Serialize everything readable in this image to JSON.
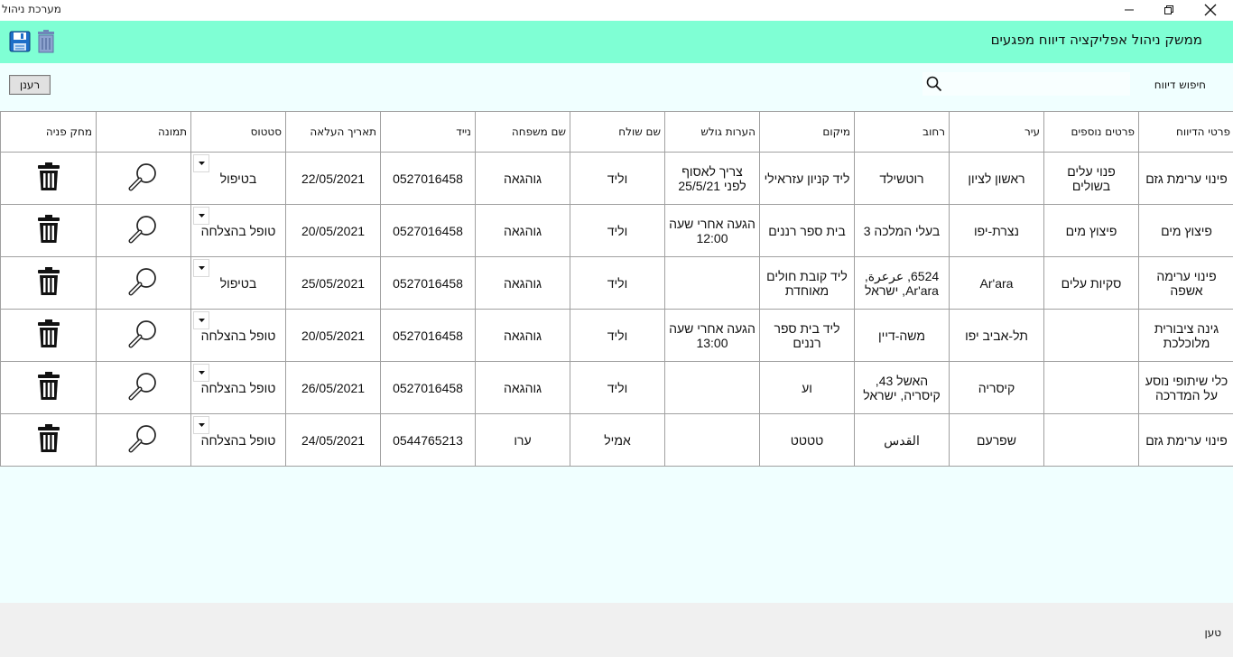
{
  "window": {
    "title": "מערכת ניהול",
    "controls": [
      "minimize",
      "restore",
      "close"
    ]
  },
  "banner": {
    "title": "ממשק ניהול אפליקציה דיווח מפגעים",
    "color": "#7fffd4",
    "icons": [
      "save-icon",
      "trash-icon"
    ]
  },
  "toolbar": {
    "refresh_label": "רענן",
    "search_label": "חיפוש דיווח",
    "search_value": ""
  },
  "table": {
    "columns": [
      "פרטי הדיווח",
      "פרטים נוספים",
      "עיר",
      "רחוב",
      "מיקום",
      "הערות גולש",
      "שם שולח",
      "שם משפחה",
      "נייד",
      "תאריך העלאה",
      "סטטוס",
      "תמונה",
      "מחק פניה"
    ],
    "rows": [
      {
        "details": "פינוי ערימת גזם",
        "extra": "פנוי עלים בשולים",
        "city": "ראשון לציון",
        "street": "רוטשילד",
        "location": "ליד קניון עזראילי",
        "notes": "צריך לאסוף לפני 25/5/21",
        "first_name": "וליד",
        "last_name": "גוהגאה",
        "phone": "0527016458",
        "date": "22/05/2021",
        "status": "בטיפול"
      },
      {
        "details": "פיצוץ מים",
        "extra": "פיצוץ מים",
        "city": "נצרת-יפו",
        "street": "בעלי המלכה 3",
        "location": "בית ספר רננים",
        "notes": "הגעה אחרי שעה 12:00",
        "first_name": "וליד",
        "last_name": "גוהגאה",
        "phone": "0527016458",
        "date": "20/05/2021",
        "status": "טופל בהצלחה"
      },
      {
        "details": "פינוי ערימה אשפה",
        "extra": "סקיות עלים",
        "city": "Ar'ara",
        "street": "6524, عرعرة, Ar'ara, ישראל",
        "location": "ליד קובת חולים מאוחדת",
        "notes": "",
        "first_name": "וליד",
        "last_name": "גוהגאה",
        "phone": "0527016458",
        "date": "25/05/2021",
        "status": "בטיפול"
      },
      {
        "details": "גינה ציבורית מלוכלכת",
        "extra": "",
        "city": "תל-אביב יפו",
        "street": "משה-דיין",
        "location": "ליד בית ספר רננים",
        "notes": "הגעה אחרי שעה 13:00",
        "first_name": "וליד",
        "last_name": "גוהגאה",
        "phone": "0527016458",
        "date": "20/05/2021",
        "status": "טופל בהצלחה"
      },
      {
        "details": "כלי שיתופי נוסע על המדרכה",
        "extra": "",
        "city": "קיסריה",
        "street": "האשל 43, קיסריה, ישראל",
        "location": "וע",
        "notes": "",
        "first_name": "וליד",
        "last_name": "גוהגאה",
        "phone": "0527016458",
        "date": "26/05/2021",
        "status": "טופל בהצלחה"
      },
      {
        "details": "פינוי ערימת גזם",
        "extra": "",
        "city": "שפרעם",
        "street": "القدس",
        "location": "טטטט",
        "notes": "",
        "first_name": "אמיל",
        "last_name": "ערו",
        "phone": "0544765213",
        "date": "24/05/2021",
        "status": "טופל בהצלחה"
      }
    ]
  },
  "footer": {
    "status_text": "טען"
  }
}
